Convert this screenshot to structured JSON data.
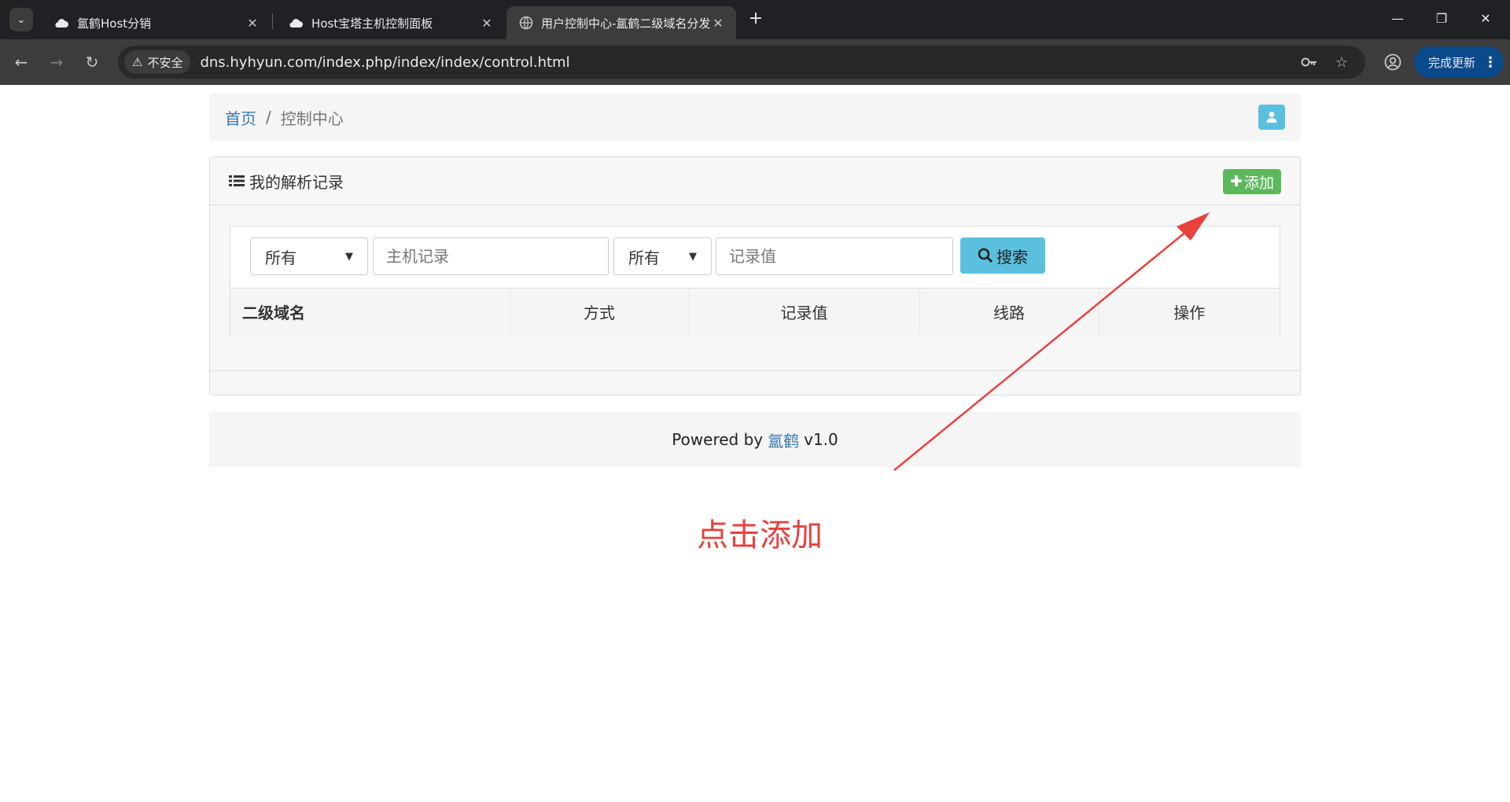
{
  "browser": {
    "tabs": [
      {
        "title": "氲鹤Host分销",
        "icon": "cloud-icon"
      },
      {
        "title": "Host宝塔主机控制面板",
        "icon": "cloud-icon"
      },
      {
        "title": "用户控制中心-氲鹤二级域名分发",
        "icon": "globe-icon",
        "active": true
      }
    ],
    "security_label": "不安全",
    "url": "dns.hyhyun.com/index.php/index/index/control.html",
    "update_label": "完成更新"
  },
  "breadcrumb": {
    "home": "首页",
    "separator": "/",
    "current": "控制中心"
  },
  "panel": {
    "title": "我的解析记录",
    "add_label": "添加",
    "filters": {
      "select1": "所有",
      "host_placeholder": "主机记录",
      "select2": "所有",
      "value_placeholder": "记录值",
      "search_label": "搜索"
    },
    "columns": [
      "二级域名",
      "方式",
      "记录值",
      "线路",
      "操作"
    ]
  },
  "footer": {
    "prefix": "Powered by",
    "link": "氲鹤",
    "version": "v1.0"
  },
  "annotation": {
    "text": "点击添加",
    "color": "#e8413e"
  },
  "colors": {
    "add_button": "#5cb85c",
    "search_button": "#5bc0de",
    "link": "#337ab7"
  }
}
